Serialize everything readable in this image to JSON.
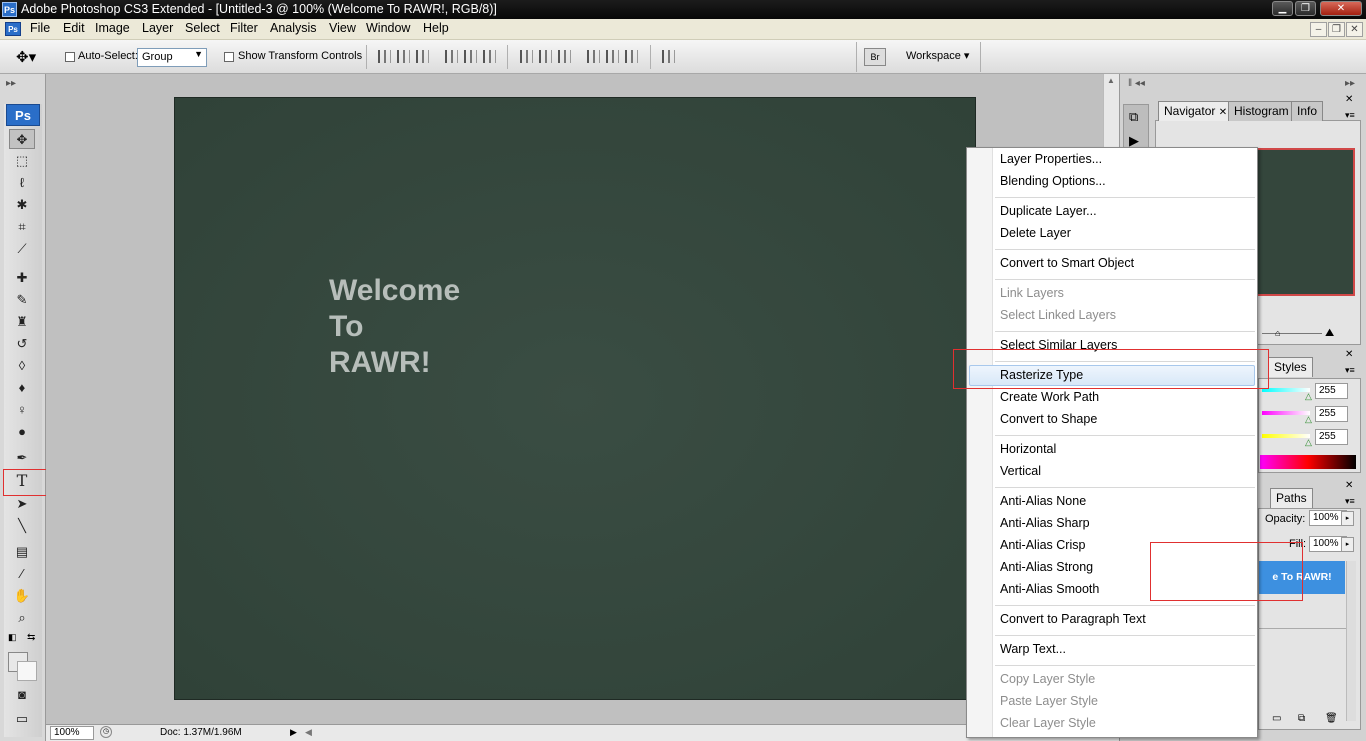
{
  "window": {
    "title": "Adobe Photoshop CS3 Extended - [Untitled-3 @ 100% (Welcome To RAWR!, RGB/8)]",
    "app_badge": "Ps",
    "min_icon": "minimize-icon",
    "max_icon": "maximize-icon",
    "close_icon": "close-icon"
  },
  "menubar": {
    "doc_badge": "Ps",
    "items": [
      "File",
      "Edit",
      "Image",
      "Layer",
      "Select",
      "Filter",
      "Analysis",
      "View",
      "Window",
      "Help"
    ]
  },
  "options": {
    "auto_select_label": "Auto-Select:",
    "auto_select_value": "Group",
    "show_transform_label": "Show Transform Controls",
    "workspace_label": "Workspace ▾"
  },
  "toolbox": {
    "logo": "Ps",
    "tools": [
      {
        "name": "move-tool-icon",
        "glyph": "✥"
      },
      {
        "name": "marquee-tool-icon",
        "glyph": "⬚"
      },
      {
        "name": "lasso-tool-icon",
        "glyph": "ℓ"
      },
      {
        "name": "magic-wand-tool-icon",
        "glyph": "✱"
      },
      {
        "name": "crop-tool-icon",
        "glyph": "⌗"
      },
      {
        "name": "slice-tool-icon",
        "glyph": "⟋"
      },
      {
        "name": "healing-brush-tool-icon",
        "glyph": "✚"
      },
      {
        "name": "brush-tool-icon",
        "glyph": "✎"
      },
      {
        "name": "clone-stamp-tool-icon",
        "glyph": "♜"
      },
      {
        "name": "history-brush-tool-icon",
        "glyph": "↺"
      },
      {
        "name": "eraser-tool-icon",
        "glyph": "◊"
      },
      {
        "name": "paint-bucket-tool-icon",
        "glyph": "♦"
      },
      {
        "name": "dodge-tool-icon",
        "glyph": "♀"
      },
      {
        "name": "blur-tool-icon",
        "glyph": "●"
      },
      {
        "name": "pen-tool-icon",
        "glyph": "✒"
      },
      {
        "name": "type-tool-icon",
        "glyph": "T"
      },
      {
        "name": "path-selection-tool-icon",
        "glyph": "➤"
      },
      {
        "name": "line-tool-icon",
        "glyph": "╲"
      },
      {
        "name": "notes-tool-icon",
        "glyph": "▤"
      },
      {
        "name": "eyedropper-tool-icon",
        "glyph": "⁄"
      },
      {
        "name": "hand-tool-icon",
        "glyph": "✋"
      },
      {
        "name": "zoom-tool-icon",
        "glyph": "⌕"
      },
      {
        "name": "quick-mask-icon",
        "glyph": "◙"
      },
      {
        "name": "screen-mode-icon",
        "glyph": "▭"
      }
    ]
  },
  "canvas": {
    "text_lines": [
      "Welcome",
      "To",
      "RAWR!"
    ]
  },
  "status": {
    "zoom": "100%",
    "doc_info": "Doc: 1.37M/1.96M"
  },
  "panels": {
    "navigator_tabs": [
      "Navigator",
      "Histogram",
      "Info"
    ],
    "styles_tab": "Styles",
    "color_values": [
      "255",
      "255",
      "255"
    ],
    "paths_tab": "Paths",
    "opacity_label": "Opacity:",
    "opacity_value": "100%",
    "fill_label": "Fill:",
    "fill_value": "100%",
    "layer_name": "e To RAWR!"
  },
  "context_menu": {
    "items": [
      {
        "label": "Layer Properties...",
        "enabled": true
      },
      {
        "label": "Blending Options...",
        "enabled": true
      },
      {
        "label": "Duplicate Layer...",
        "enabled": true
      },
      {
        "label": "Delete Layer",
        "enabled": true
      },
      {
        "label": "Convert to Smart Object",
        "enabled": true
      },
      {
        "label": "Link Layers",
        "enabled": false
      },
      {
        "label": "Select Linked Layers",
        "enabled": false
      },
      {
        "label": "Select Similar Layers",
        "enabled": true
      },
      {
        "label": "Rasterize Type",
        "enabled": true,
        "highlighted": true
      },
      {
        "label": "Create Work Path",
        "enabled": true
      },
      {
        "label": "Convert to Shape",
        "enabled": true
      },
      {
        "label": "Horizontal",
        "enabled": true
      },
      {
        "label": "Vertical",
        "enabled": true
      },
      {
        "label": "Anti-Alias None",
        "enabled": true
      },
      {
        "label": "Anti-Alias Sharp",
        "enabled": true
      },
      {
        "label": "Anti-Alias Crisp",
        "enabled": true
      },
      {
        "label": "Anti-Alias Strong",
        "enabled": true
      },
      {
        "label": "Anti-Alias Smooth",
        "enabled": true
      },
      {
        "label": "Convert to Paragraph Text",
        "enabled": true
      },
      {
        "label": "Warp Text...",
        "enabled": true
      },
      {
        "label": "Copy Layer Style",
        "enabled": false
      },
      {
        "label": "Paste Layer Style",
        "enabled": false
      },
      {
        "label": "Clear Layer Style",
        "enabled": false
      }
    ]
  },
  "colors": {
    "canvas_bg": "#34463c",
    "highlight_box": "#e03030",
    "layer_selected": "#3d90e0"
  }
}
